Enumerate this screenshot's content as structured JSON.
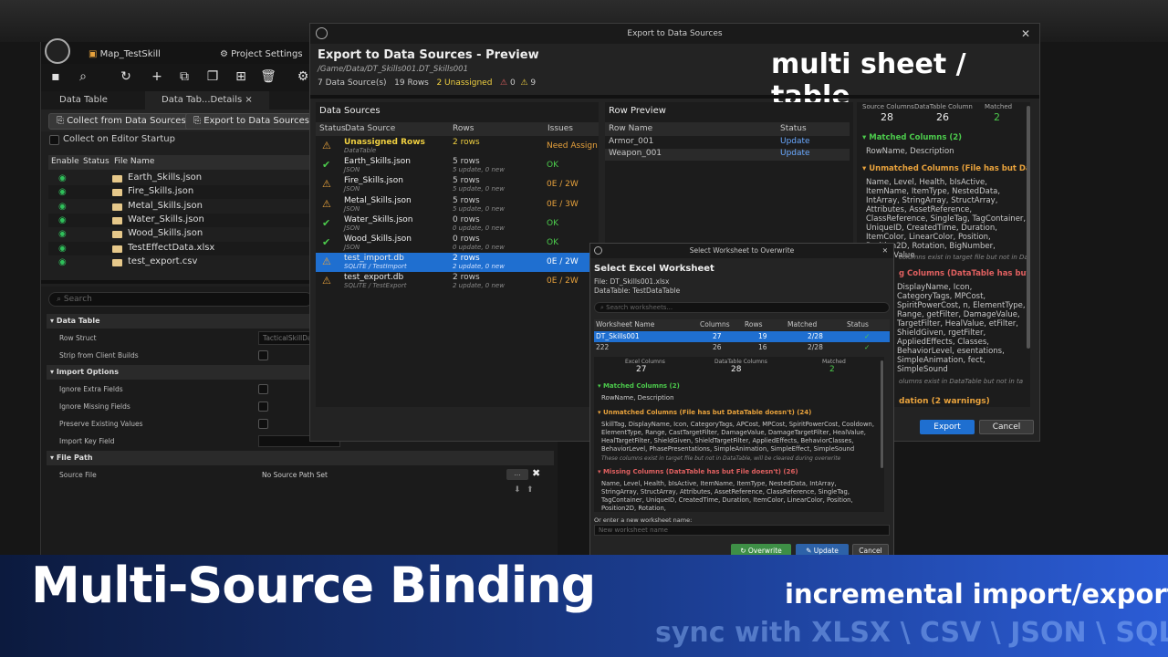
{
  "editor": {
    "tab1": "Map_TestSkill",
    "tab2": "Project Settings",
    "subtab1": "Data Table",
    "subtab2": "Data Tab...Details",
    "btn_collect": "Collect from Data Sources",
    "btn_export": "Export to Data Sources",
    "collect_startup": "Collect on Editor Startup",
    "list_headers": [
      "Enable",
      "Status",
      "File Name"
    ],
    "files": [
      "Earth_Skills.json",
      "Fire_Skills.json",
      "Metal_Skills.json",
      "Water_Skills.json",
      "Wood_Skills.json",
      "TestEffectData.xlsx",
      "test_export.csv"
    ],
    "search_placeholder": "Search",
    "sec_datatable": "Data Table",
    "row_struct": "Row Struct",
    "row_struct_val": "TacticalSkillData",
    "strip": "Strip from Client Builds",
    "sec_import": "Import Options",
    "ignore_extra": "Ignore Extra Fields",
    "ignore_missing": "Ignore Missing Fields",
    "preserve": "Preserve Existing Values",
    "import_key": "Import Key Field",
    "sec_filepath": "File Path",
    "source_file": "Source File",
    "no_source": "No Source Path Set",
    "dots": "..."
  },
  "dialog": {
    "window_title": "Export to Data Sources",
    "title": "Export to Data Sources - Preview",
    "path": "/Game/Data/DT_Skills001.DT_Skills001",
    "sources": "7 Data Source(s)",
    "rows": "19 Rows",
    "unassigned": "2 Unassigned",
    "err_count": "0",
    "warn_count": "9",
    "overlay": "multi sheet / table",
    "ds_title": "Data Sources",
    "ds_headers": [
      "Status",
      "Data Source",
      "Rows",
      "Issues"
    ],
    "ds_rows": [
      {
        "status": "warn",
        "name": "Unassigned Rows",
        "sub": "DataTable",
        "rows": "2 rows",
        "rsub": "",
        "issue": "Need Assign",
        "hl": "yellow"
      },
      {
        "status": "ok",
        "name": "Earth_Skills.json",
        "sub": "JSON",
        "rows": "5 rows",
        "rsub": "5 update, 0 new",
        "issue": "OK"
      },
      {
        "status": "warn",
        "name": "Fire_Skills.json",
        "sub": "JSON",
        "rows": "5 rows",
        "rsub": "5 update, 0 new",
        "issue": "0E / 2W"
      },
      {
        "status": "warn",
        "name": "Metal_Skills.json",
        "sub": "JSON",
        "rows": "5 rows",
        "rsub": "5 update, 0 new",
        "issue": "0E / 3W"
      },
      {
        "status": "ok",
        "name": "Water_Skills.json",
        "sub": "JSON",
        "rows": "0 rows",
        "rsub": "0 update, 0 new",
        "issue": "OK"
      },
      {
        "status": "ok",
        "name": "Wood_Skills.json",
        "sub": "JSON",
        "rows": "0 rows",
        "rsub": "0 update, 0 new",
        "issue": "OK"
      },
      {
        "status": "warn",
        "name": "test_import.db",
        "sub": "SQLITE / TestImport",
        "rows": "2 rows",
        "rsub": "2 update, 0 new",
        "issue": "0E / 2W",
        "sel": true
      },
      {
        "status": "warn",
        "name": "test_export.db",
        "sub": "SQLITE / TestExport",
        "rows": "2 rows",
        "rsub": "2 update, 0 new",
        "issue": "0E / 2W"
      }
    ],
    "rp_title": "Row Preview",
    "rp_headers": [
      "Row Name",
      "Status"
    ],
    "rp_rows": [
      [
        "Armor_001",
        "Update"
      ],
      [
        "Weapon_001",
        "Update"
      ]
    ],
    "rc": {
      "src_label": "Source Columns",
      "src": "28",
      "dt_label": "DataTable Column",
      "dt": "26",
      "m_label": "Matched",
      "m": "2",
      "matched_title": "Matched Columns (2)",
      "matched": "RowName, Description",
      "unmatched_title": "Unmatched Columns (File has but DataTab",
      "unmatched": "Name, Level, Health, bIsActive, ItemName, ItemType, NestedData, IntArray, StringArray, StructArray, Attributes, AssetReference, ClassReference, SingleTag, TagContainer, UniqueID, CreatedTime, Duration, ItemColor, LinearColor, Position, Position2D, Rotation, BigNumber, PreciseValue",
      "unmatched_note": "columns exist in target file but not in Dat",
      "missing_title": "g Columns (DataTable has but File do",
      "missing": "DisplayName, Icon, CategoryTags, MPCost, SpiritPowerCost, n, ElementType, Range, getFilter, DamageValue, TargetFilter, HealValue, etFilter, ShieldGiven, rgetFilter, AppliedEffects, Classes, BehaviorLevel, esentations, SimpleAnimation, fect, SimpleSound",
      "missing_note": "olumns exist in DataTable but not in ta",
      "val": "dation (2 warnings)"
    },
    "export": "Export",
    "cancel": "Cancel"
  },
  "ws": {
    "window_title": "Select Worksheet to Overwrite",
    "title": "Select Excel Worksheet",
    "file": "File: DT_Skills001.xlsx",
    "datatable": "DataTable: TestDataTable",
    "search_placeholder": "Search worksheets...",
    "headers": [
      "Worksheet Name",
      "Columns",
      "Rows",
      "Matched",
      "Status"
    ],
    "rows": [
      [
        "DT_Skills001",
        "27",
        "19",
        "2/28",
        "✓"
      ],
      [
        "222",
        "26",
        "16",
        "2/28",
        "✓"
      ]
    ],
    "ex_label": "Excel Columns",
    "ex": "27",
    "dt_label": "DataTable Columns",
    "dt": "28",
    "m_label": "Matched",
    "m": "2",
    "matched_title": "Matched Columns (2)",
    "matched": "RowName, Description",
    "unmatched_title": "Unmatched Columns (File has but DataTable doesn't) (24)",
    "unmatched": "SkillTag, DisplayName, Icon, CategoryTags, APCost, MPCost, SpiritPowerCost, Cooldown, ElementType, Range, CastTargetFilter, DamageValue, DamageTargetFilter, HealValue, HealTargetFilter, ShieldGiven, ShieldTargetFilter, AppliedEffects, BehaviorClasses, BehaviorLevel, PhasePresentations, SimpleAnimation, SimpleEffect, SimpleSound",
    "unmatched_note": "These columns exist in target file but not in DataTable, will be cleared during overwrite",
    "missing_title": "Missing Columns (DataTable has but File doesn't) (26)",
    "missing": "Name, Level, Health, bIsActive, ItemName, ItemType, NestedData, IntArray, StringArray, StructArray, Attributes, AssetReference, ClassReference, SingleTag, TagContainer, UniqueID, CreatedTime, Duration, ItemColor, LinearColor, Position, Position2D, Rotation,",
    "new_label": "Or enter a new worksheet name:",
    "new_placeholder": "New worksheet name",
    "overwrite": "Overwrite",
    "update": "Update",
    "cancel": "Cancel"
  },
  "banner": {
    "title": "Multi-Source Binding",
    "sub1": "incremental import/export",
    "sub2": "sync with XLSX \\ CSV \\ JSON \\ SQLite"
  }
}
